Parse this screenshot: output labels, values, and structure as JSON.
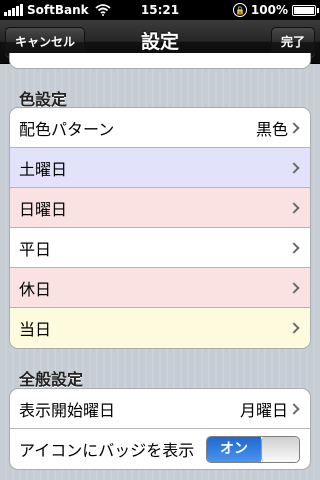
{
  "status_bar": {
    "carrier": "SoftBank",
    "time": "15:21",
    "battery": "100%",
    "battery_level": 1.0
  },
  "nav": {
    "cancel_label": "キャンセル",
    "title": "設定",
    "done_label": "完了"
  },
  "color_section": {
    "header": "色設定",
    "rows": [
      {
        "label": "配色パターン",
        "value": "黒色",
        "bg": "#ffffff"
      },
      {
        "label": "土曜日",
        "value": "",
        "bg": "#e2e2fb"
      },
      {
        "label": "日曜日",
        "value": "",
        "bg": "#fbe2e2"
      },
      {
        "label": "平日",
        "value": "",
        "bg": "#ffffff"
      },
      {
        "label": "休日",
        "value": "",
        "bg": "#fbe2e2"
      },
      {
        "label": "当日",
        "value": "",
        "bg": "#fdfbdd"
      }
    ]
  },
  "general_section": {
    "header": "全般設定",
    "start_day_label": "表示開始曜日",
    "start_day_value": "月曜日",
    "badge_label": "アイコンにバッジを表示",
    "badge_toggle": "オン"
  }
}
